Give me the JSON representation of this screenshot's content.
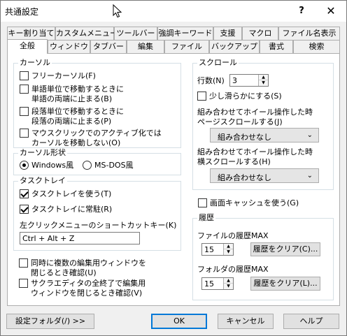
{
  "window": {
    "title": "共通設定",
    "help": "?",
    "close": "✕"
  },
  "tabs_row1": [
    "キー割り当て",
    "カスタムメニュー",
    "ツールバー",
    "強調キーワード",
    "支援",
    "マクロ",
    "ファイル名表示"
  ],
  "tabs_row2": [
    "全般",
    "ウィンドウ",
    "タブバー",
    "編集",
    "ファイル",
    "バックアップ",
    "書式",
    "検索"
  ],
  "active_tab": "全般",
  "cursor_group": {
    "title": "カーソル",
    "free_cursor": {
      "label": "フリーカーソル(F)",
      "checked": false
    },
    "word_move": {
      "label1": "単語単位で移動するときに",
      "label2": "単語の両端に止まる(B)",
      "checked": false
    },
    "para_move": {
      "label1": "段落単位で移動するときに",
      "label2": "段落の両端に止まる(P)",
      "checked": false
    },
    "mouse_activate": {
      "label1": "マウスクリックでのアクティブ化では",
      "label2": "カーソルを移動しない(O)",
      "checked": false
    }
  },
  "cursor_shape": {
    "title": "カーソル形状",
    "windows": {
      "label": "Windows風",
      "selected": true
    },
    "msdos": {
      "label": "MS-DOS風",
      "selected": false
    }
  },
  "tasktray": {
    "title": "タスクトレイ",
    "use": {
      "label": "タスクトレイを使う(T)",
      "checked": true
    },
    "resident": {
      "label": "タスクトレイに常駐(R)",
      "checked": true
    },
    "shortcut_label": "左クリックメニューのショートカットキー(K)",
    "shortcut_value": "Ctrl + Alt + Z"
  },
  "misc": {
    "multi_close": {
      "label1": "同時に複数の編集用ウィンドウを",
      "label2": "閉じるとき確認(U)",
      "checked": false
    },
    "exit_close": {
      "label1": "サクラエディタの全終了で編集用",
      "label2": "ウィンドウを閉じるとき確認(V)",
      "checked": false
    }
  },
  "scroll": {
    "title": "スクロール",
    "lines_label": "行数(N)",
    "lines_value": "3",
    "smooth": {
      "label": "少し滑らかにする(S)",
      "checked": false
    },
    "page_wheel_label1": "組み合わせてホイール操作した時",
    "page_wheel_label2": "ページスクロールする(J)",
    "page_wheel_value": "組み合わせなし",
    "horiz_wheel_label1": "組み合わせてホイール操作した時",
    "horiz_wheel_label2": "横スクロールする(H)",
    "horiz_wheel_value": "組み合わせなし"
  },
  "screen_cache": {
    "label": "画面キャッシュを使う(G)",
    "checked": false
  },
  "history": {
    "title": "履歴",
    "file_label": "ファイルの履歴MAX",
    "file_value": "15",
    "file_clear": "履歴をクリア(C)...",
    "folder_label": "フォルダの履歴MAX",
    "folder_value": "15",
    "folder_clear": "履歴をクリア(L)..."
  },
  "footer": {
    "settings_folder": "設定フォルダ(/) >>",
    "ok": "OK",
    "cancel": "キャンセル",
    "help": "ヘルプ"
  }
}
